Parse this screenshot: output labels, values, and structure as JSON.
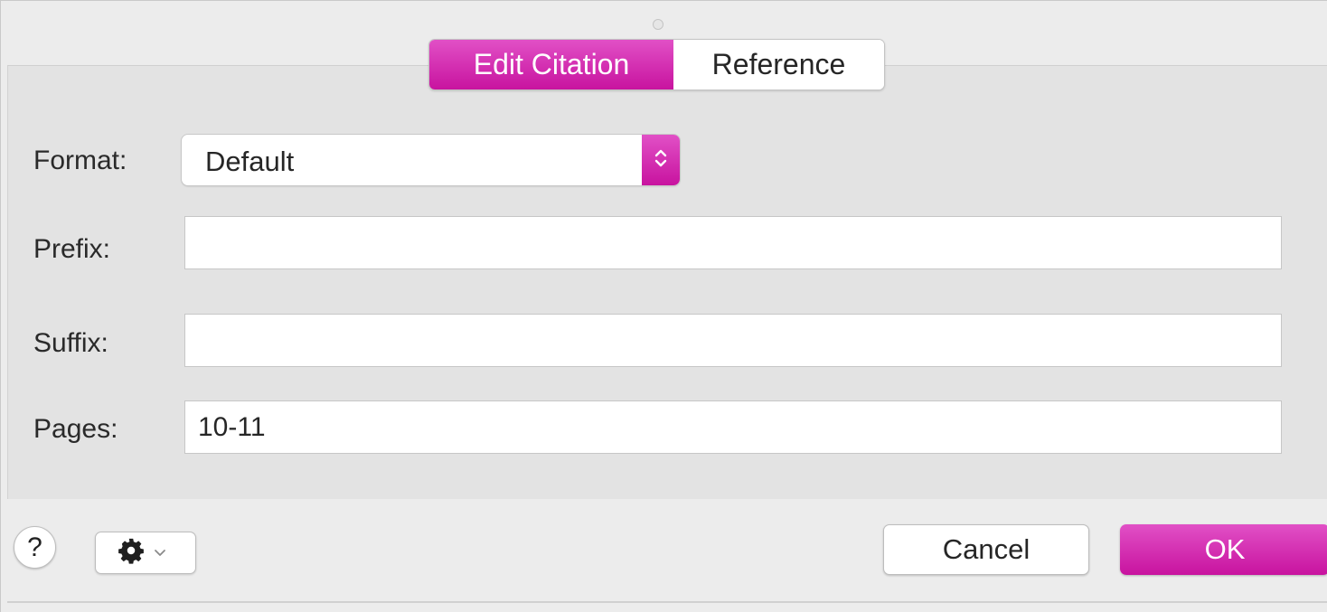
{
  "dialog": {
    "tabs": [
      {
        "label": "Edit Citation",
        "active": true
      },
      {
        "label": "Reference",
        "active": false
      }
    ],
    "fields": {
      "format": {
        "label": "Format:",
        "value": "Default"
      },
      "prefix": {
        "label": "Prefix:",
        "value": ""
      },
      "suffix": {
        "label": "Suffix:",
        "value": ""
      },
      "pages": {
        "label": "Pages:",
        "value": "10-11"
      }
    }
  },
  "footer": {
    "help_label": "?",
    "action_menu_icon": "gear-icon",
    "cancel_label": "Cancel",
    "ok_label": "OK"
  },
  "colors": {
    "accent": "#d62fb5",
    "window_background": "#ececec",
    "panel_background": "#e3e3e3"
  }
}
